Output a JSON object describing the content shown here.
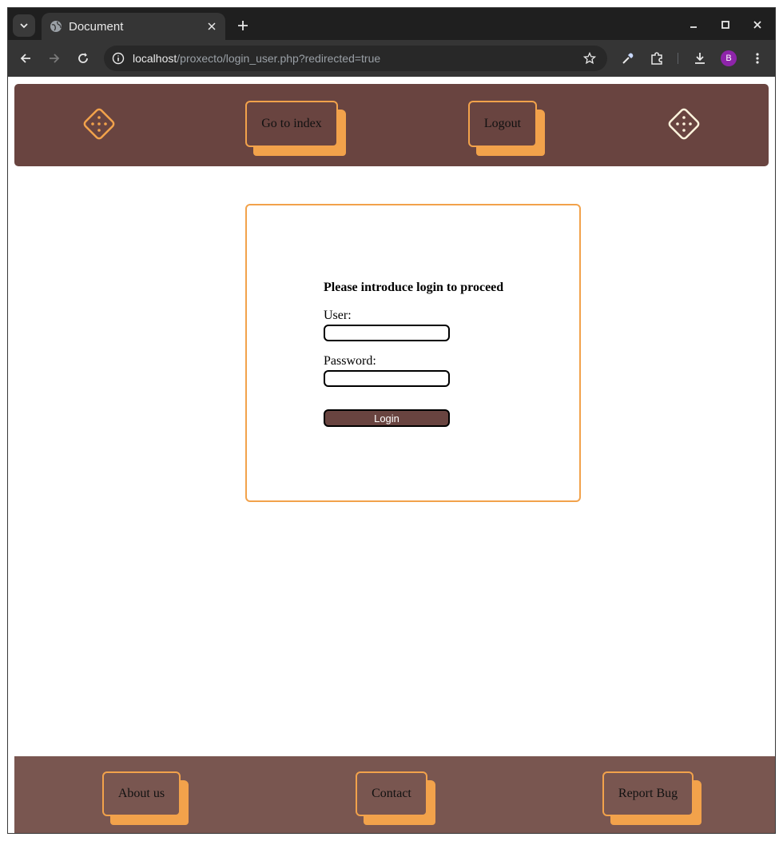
{
  "browser": {
    "tab_title": "Document",
    "url_host": "localhost",
    "url_path": "/proxecto/login_user.php?redirected=true",
    "profile_initial": "B",
    "icons": [
      "tab-search-icon",
      "globe-icon",
      "close-icon",
      "plus-icon",
      "minimize-icon",
      "maximize-icon",
      "close-window-icon",
      "back-icon",
      "forward-icon",
      "reload-icon",
      "site-info-icon",
      "bookmark-star-icon",
      "eyedropper-icon",
      "extensions-icon",
      "download-icon",
      "more-menu-icon"
    ]
  },
  "header": {
    "nav": [
      {
        "label": "Go to index"
      },
      {
        "label": "Logout"
      }
    ],
    "icons": [
      "dice-icon",
      "dice-icon"
    ]
  },
  "login": {
    "title": "Please introduce login to proceed",
    "user_label": "User:",
    "user_value": "",
    "password_label": "Password:",
    "password_value": "",
    "submit_label": "Login"
  },
  "footer": {
    "links": [
      {
        "label": "About us"
      },
      {
        "label": "Contact"
      },
      {
        "label": "Report Bug"
      }
    ]
  },
  "colors": {
    "brand_brown": "#694440",
    "footer_brown": "#795650",
    "accent_orange": "#f2a24b",
    "dice_left": "#f2a24b",
    "dice_right": "#fff3dc"
  }
}
